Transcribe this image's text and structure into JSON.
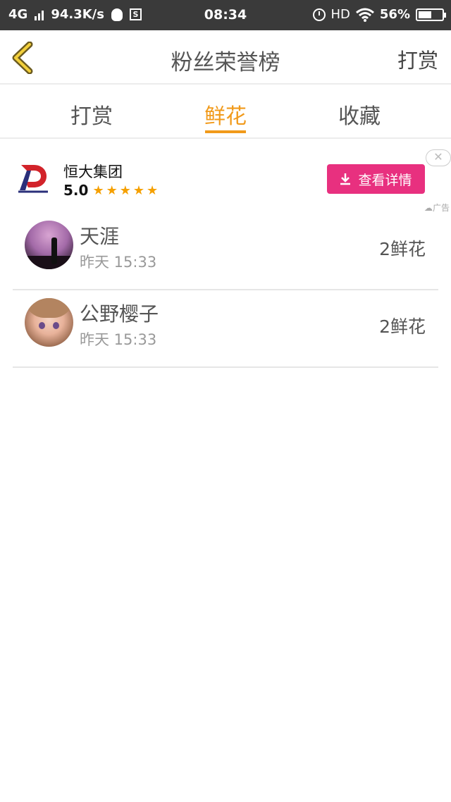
{
  "status_bar": {
    "network": "4G",
    "speed": "94.3K/s",
    "sim_icon_letter": "S",
    "time": "08:34",
    "hd": "HD",
    "battery": "56%",
    "battery_level": 0.56
  },
  "header": {
    "title": "粉丝荣誉榜",
    "right_action": "打赏",
    "back_icon": "chevron-left-icon"
  },
  "tabs": [
    {
      "label": "打赏",
      "active": false
    },
    {
      "label": "鲜花",
      "active": true
    },
    {
      "label": "收藏",
      "active": false
    }
  ],
  "ad": {
    "name": "恒大集团",
    "rating": "5.0",
    "stars": "★★★★★",
    "button_label": "查看详情",
    "close": "✕",
    "tag": "广告"
  },
  "list": [
    {
      "name": "天涯",
      "time": "昨天 15:33",
      "count": "2鲜花"
    },
    {
      "name": "公野樱子",
      "time": "昨天 15:33",
      "count": "2鲜花"
    }
  ],
  "colors": {
    "accent": "#f19a1b",
    "ad_button": "#e8307f",
    "status_bar": "#3a3a3a"
  }
}
